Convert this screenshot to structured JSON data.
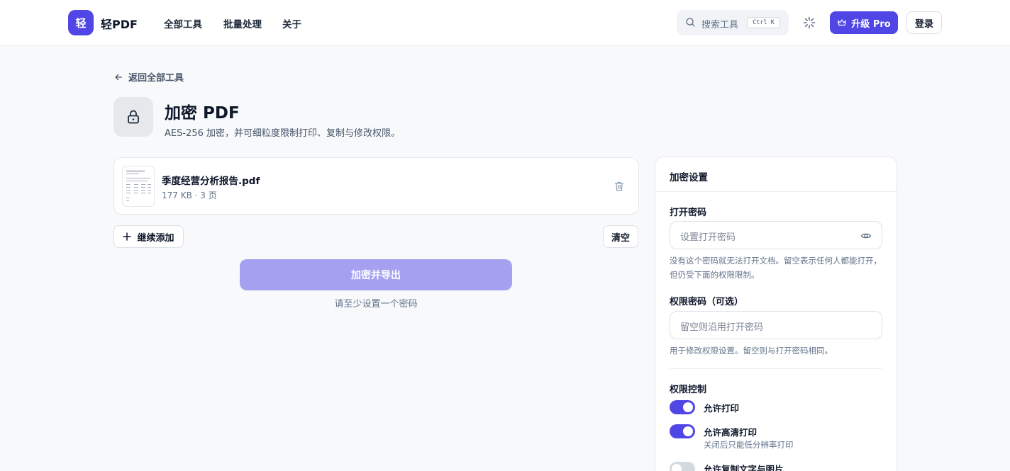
{
  "header": {
    "logo_char": "轻",
    "brand": "轻PDF",
    "nav": [
      "全部工具",
      "批量处理",
      "关于"
    ],
    "search_placeholder": "搜索工具",
    "search_shortcut": "Ctrl K",
    "pro_label": "升级 Pro",
    "login_label": "登录"
  },
  "page": {
    "back_label": "返回全部工具",
    "title": "加密 PDF",
    "subtitle": "AES-256 加密，并可细粒度限制打印、复制与修改权限。"
  },
  "file": {
    "name": "季度经营分析报告.pdf",
    "meta": "177 KB · 3 页"
  },
  "actions": {
    "add_more": "继续添加",
    "clear": "清空",
    "encrypt_export": "加密并导出",
    "encrypt_hint": "请至少设置一个密码"
  },
  "settings": {
    "title": "加密设置",
    "open_password_label": "打开密码",
    "open_password_placeholder": "设置打开密码",
    "open_password_help": "没有这个密码就无法打开文档。留空表示任何人都能打开，但仍受下面的权限限制。",
    "perm_password_label": "权限密码（可选）",
    "perm_password_placeholder": "留空则沿用打开密码",
    "perm_password_help": "用于修改权限设置。留空则与打开密码相同。",
    "permissions_label": "权限控制",
    "toggles": [
      {
        "label": "允许打印",
        "sub": "",
        "on": true
      },
      {
        "label": "允许高清打印",
        "sub": "关闭后只能低分辨率打印",
        "on": true
      },
      {
        "label": "允许复制文字与图片",
        "sub": "",
        "on": false
      }
    ]
  },
  "colors": {
    "accent": "#4f46e5",
    "accent_disabled": "#a5a1f0",
    "background": "#f8f9fb"
  }
}
